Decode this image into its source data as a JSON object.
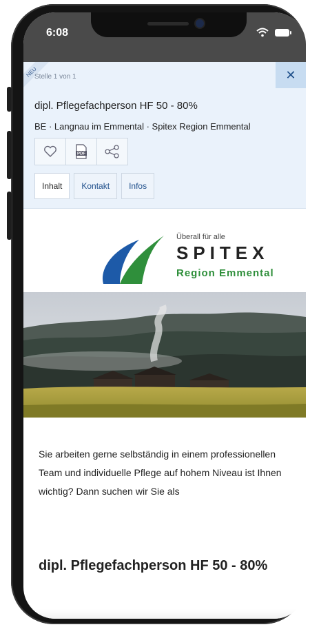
{
  "status_bar": {
    "time": "6:08"
  },
  "job_header": {
    "ribbon_label": "NEU",
    "counter": "Stelle 1 von 1",
    "close_label": "✕",
    "title": "dipl. Pflegefachperson HF 50 - 80%",
    "location": "BE · Langnau im Emmental · Spitex Region Emmental",
    "actions": {
      "favorite_icon": "heart-icon",
      "pdf_icon": "pdf-icon",
      "share_icon": "share-icon",
      "pdf_label": "PDF"
    },
    "tabs": [
      "Inhalt",
      "Kontakt",
      "Infos"
    ],
    "active_tab": "Inhalt"
  },
  "company_logo": {
    "tagline": "Überall für alle",
    "name": "SPITEX",
    "region": "Region Emmental",
    "colors": {
      "blue": "#1d5aa8",
      "green": "#2f8f3b"
    }
  },
  "content": {
    "intro": "Sie arbeiten gerne selbständig in einem professionellen Team und individuelle Pflege auf hohem Niveau ist Ihnen wichtig? Dann suchen wir Sie als",
    "heading": "dipl. Pflegefachperson HF 50 - 80%"
  },
  "colors": {
    "header_bg": "#eaf2fb",
    "accent": "#1e4f8a",
    "status_bg": "#4a4a4a"
  }
}
